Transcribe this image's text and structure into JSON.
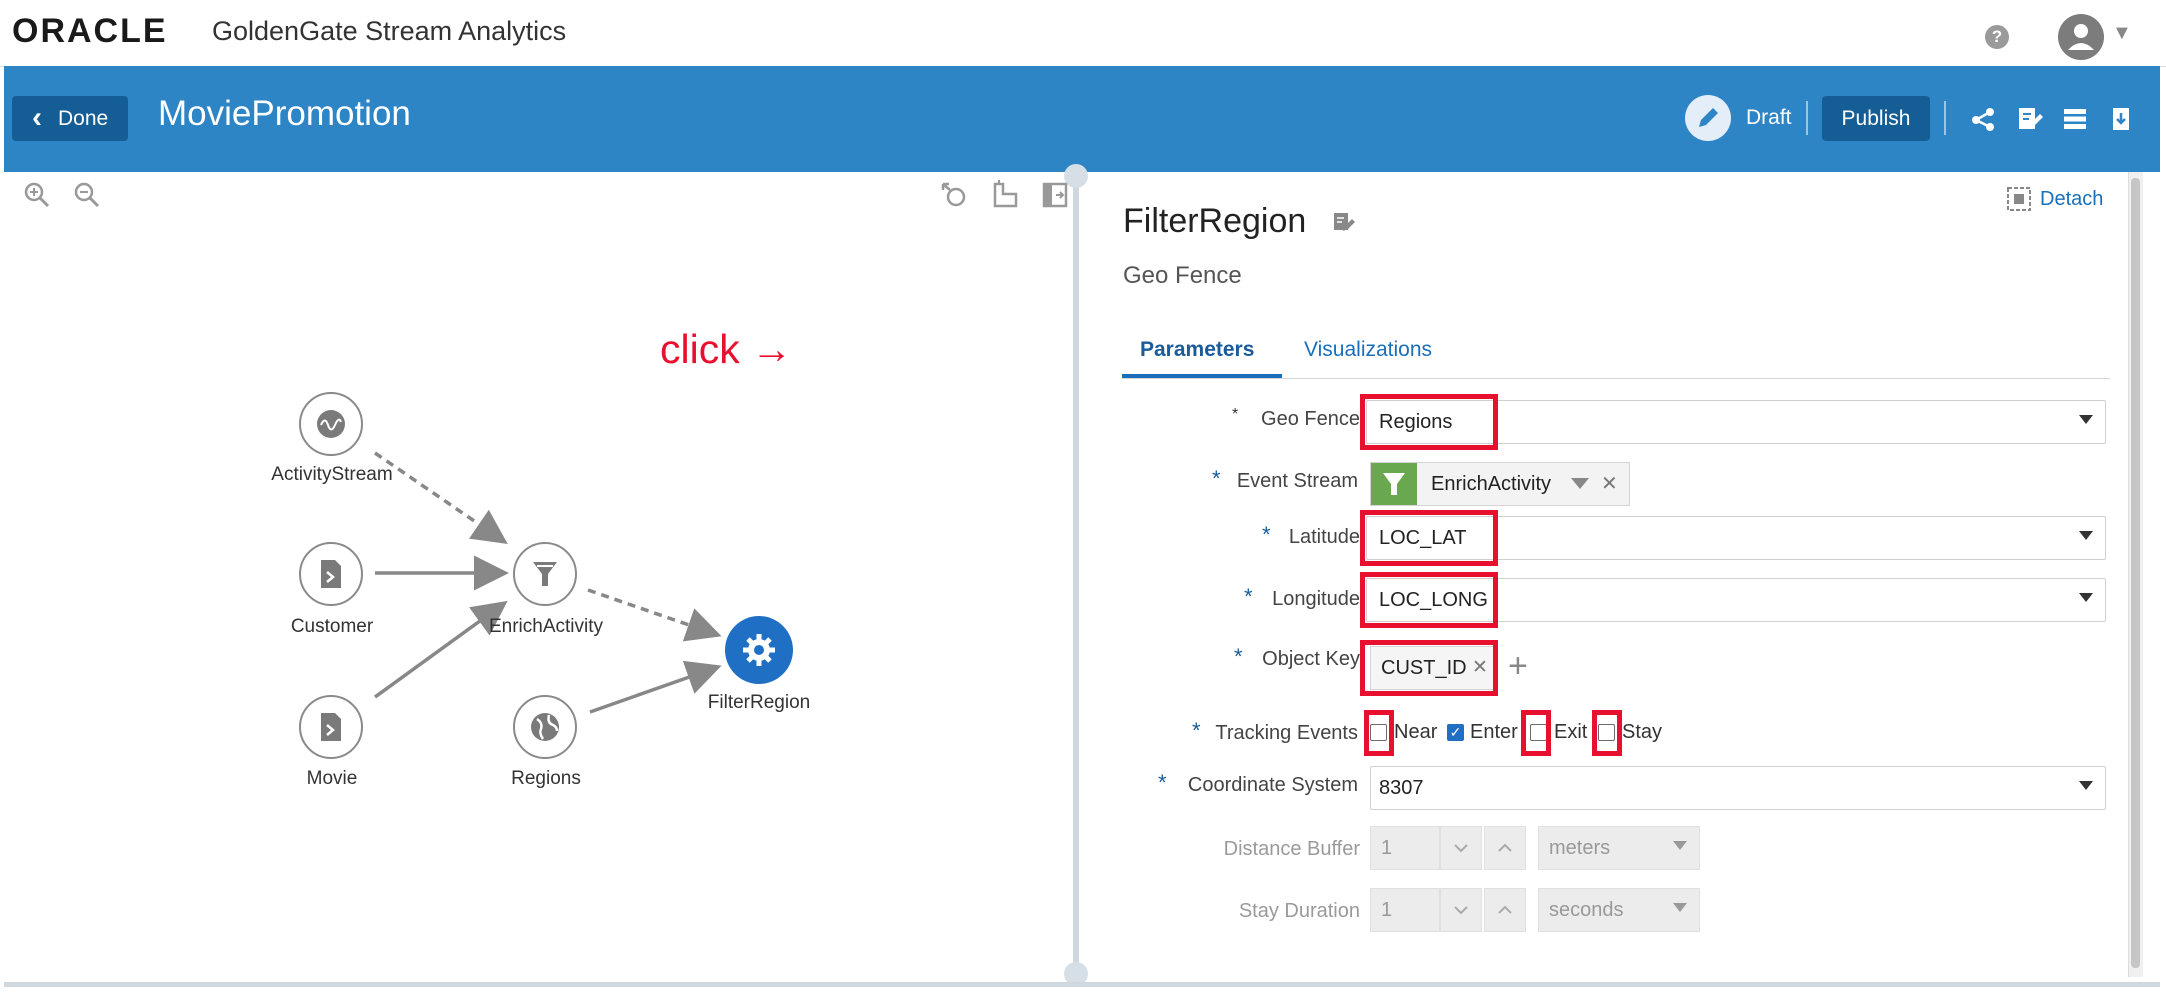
{
  "header": {
    "logo_text": "ORACLE",
    "product_name": "GoldenGate Stream Analytics",
    "help_icon": "?",
    "icons": [
      "help-icon",
      "user-avatar-icon",
      "caret-down-icon"
    ]
  },
  "pipeline_bar": {
    "done_label": "Done",
    "pipeline_name": "MoviePromotion",
    "draft_label": "Draft",
    "publish_label": "Publish",
    "icons": [
      "pencil-icon",
      "topology-icon",
      "edit-sheet-icon",
      "layout-list-icon",
      "export-icon"
    ]
  },
  "canvas": {
    "icons": [
      "zoom-in-icon",
      "zoom-out-icon",
      "reset-layout-icon",
      "layout-icon",
      "toggle-panel-icon"
    ],
    "nodes": {
      "activity_stream": "ActivityStream",
      "customer": "Customer",
      "movie": "Movie",
      "enrich_activity": "EnrichActivity",
      "regions": "Regions",
      "filter_region": "FilterRegion"
    },
    "annotation": "click →"
  },
  "panel": {
    "detach_label": "Detach",
    "stage_title": "FilterRegion",
    "stage_type": "Geo Fence",
    "tabs": {
      "parameters": "Parameters",
      "visualizations": "Visualizations"
    },
    "fields": {
      "geo_fence": {
        "label": "Geo Fence",
        "value": "Regions"
      },
      "event_stream": {
        "label": "Event Stream",
        "value": "EnrichActivity",
        "remove": "✕"
      },
      "latitude": {
        "label": "Latitude",
        "value": "LOC_LAT"
      },
      "longitude": {
        "label": "Longitude",
        "value": "LOC_LONG"
      },
      "object_key": {
        "label": "Object Key",
        "value": "CUST_ID",
        "remove": "✕",
        "add": "+"
      },
      "tracking_events": {
        "label": "Tracking Events",
        "options": [
          {
            "label": "Near",
            "checked": false
          },
          {
            "label": "Enter",
            "checked": true
          },
          {
            "label": "Exit",
            "checked": false
          },
          {
            "label": "Stay",
            "checked": false
          }
        ]
      },
      "coordinate_system": {
        "label": "Coordinate System",
        "value": "8307"
      },
      "distance_buffer": {
        "label": "Distance Buffer",
        "value": "1",
        "unit": "meters"
      },
      "stay_duration": {
        "label": "Stay Duration",
        "value": "1",
        "unit": "seconds"
      }
    },
    "required_mark": "*",
    "checkmark": "✓"
  },
  "colors": {
    "header_blue": "#2e85c6",
    "button_dark_blue": "#155e95",
    "link_blue": "#1a6fba",
    "highlight_red": "#e8102e",
    "selected_node": "#1f6fc4",
    "filter_green": "#6aa84f"
  }
}
